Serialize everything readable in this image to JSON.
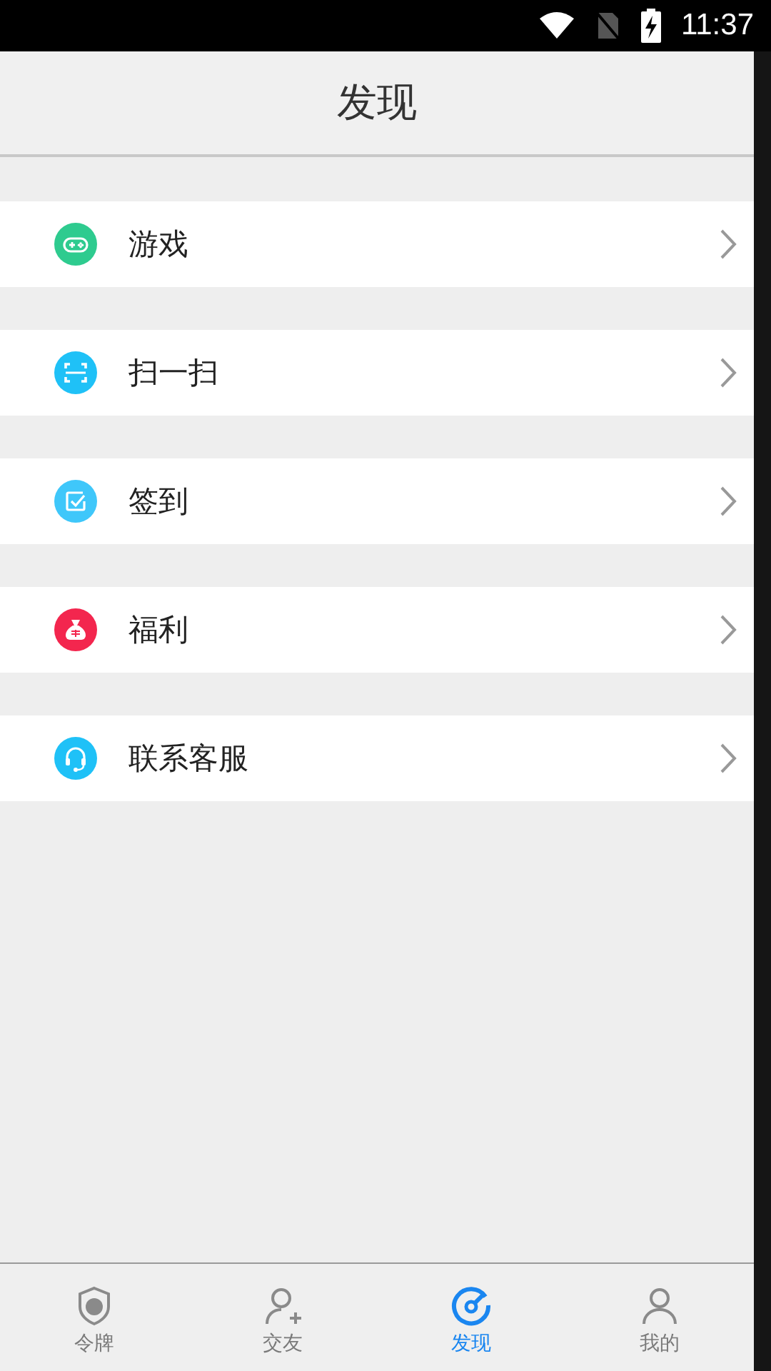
{
  "status_bar": {
    "time": "11:37"
  },
  "header": {
    "title": "发现"
  },
  "items": [
    {
      "label": "游戏",
      "kind": "game",
      "color": "#2ecb8f"
    },
    {
      "label": "扫一扫",
      "kind": "scan",
      "color": "#1fc1f7"
    },
    {
      "label": "签到",
      "kind": "checkin",
      "color": "#3fc7fa"
    },
    {
      "label": "福利",
      "kind": "gift",
      "color": "#f3264e"
    },
    {
      "label": "联系客服",
      "kind": "service",
      "color": "#1fc1f7"
    }
  ],
  "tabs": [
    {
      "label": "令牌",
      "kind": "shield",
      "selected": false
    },
    {
      "label": "交友",
      "kind": "add-friend",
      "selected": false
    },
    {
      "label": "发现",
      "kind": "discover",
      "selected": true
    },
    {
      "label": "我的",
      "kind": "person",
      "selected": false
    }
  ]
}
